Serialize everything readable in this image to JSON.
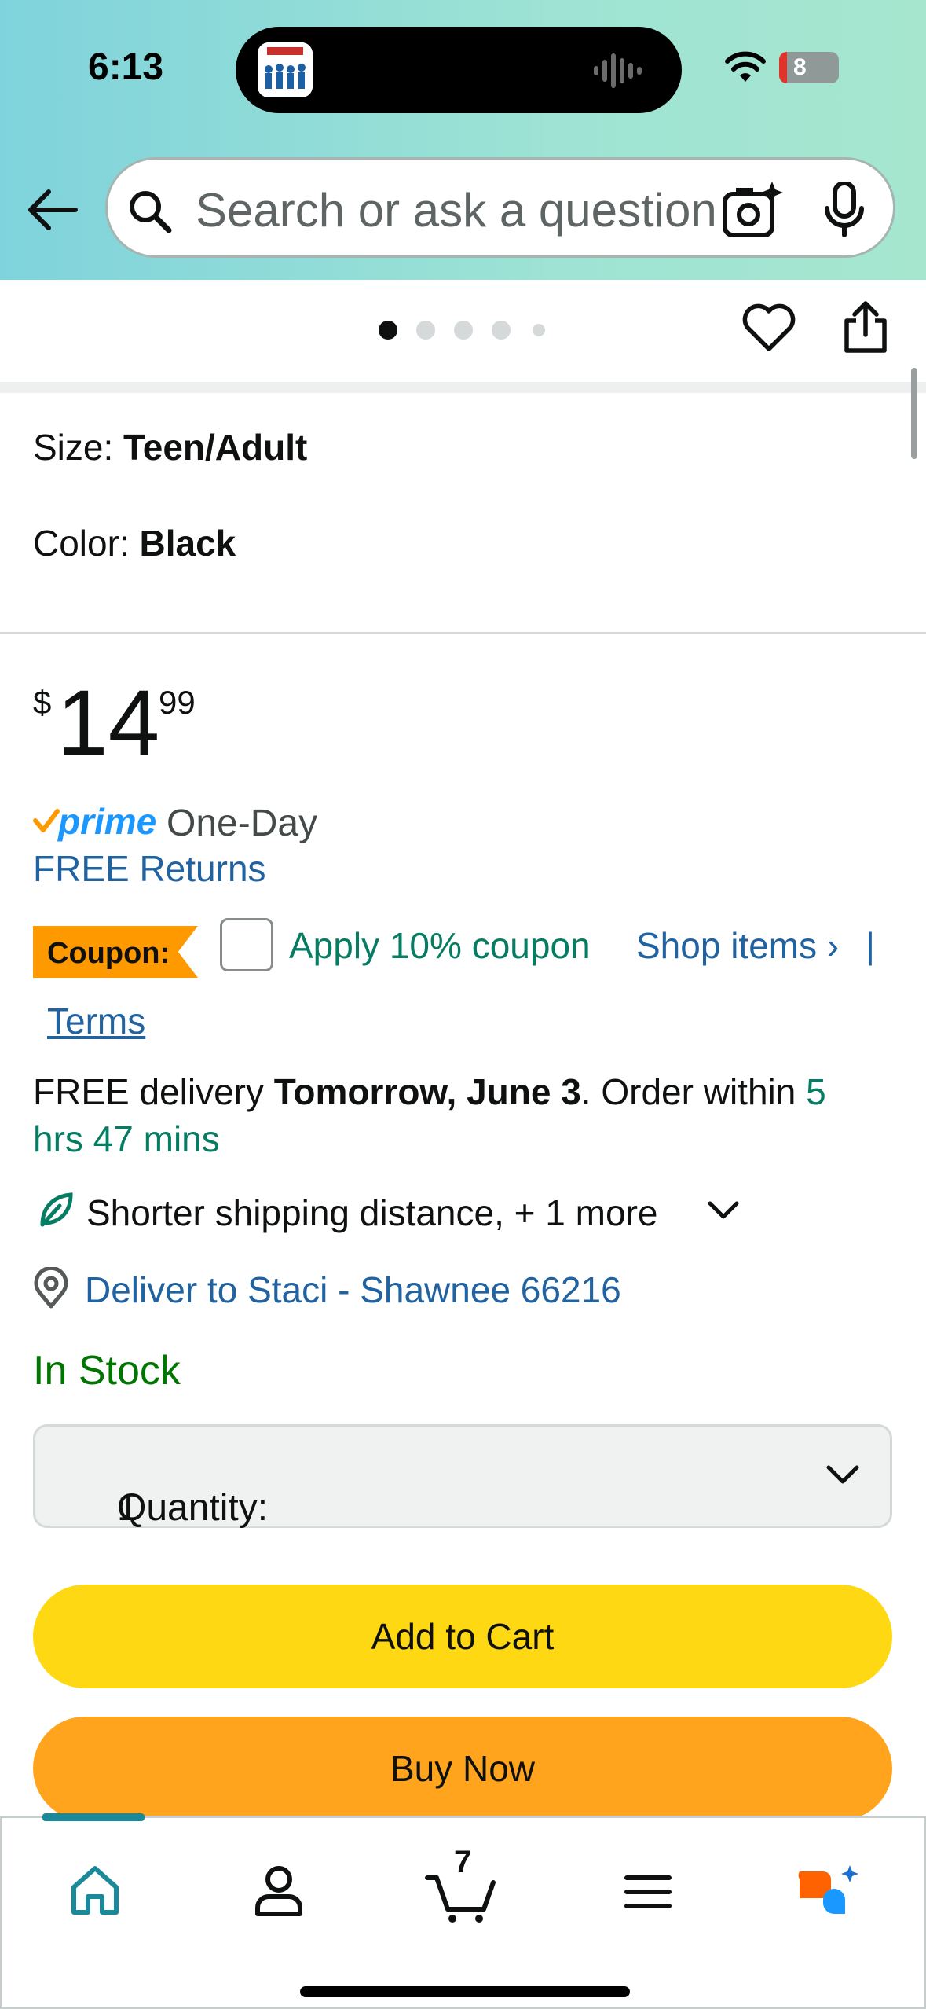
{
  "status_bar": {
    "time": "6:13",
    "battery": "8"
  },
  "search": {
    "placeholder": "Search or ask a question"
  },
  "image_carousel": {
    "dot_count": 5,
    "active_index": 0
  },
  "product": {
    "size_label": "Size:",
    "size_value": "Teen/Adult",
    "color_label": "Color:",
    "color_value": "Black",
    "price_symbol": "$",
    "price_whole": "14",
    "price_fraction": "99",
    "prime_word": "prime",
    "prime_speed": "One-Day",
    "free_returns": "FREE Returns",
    "coupon_badge": "Coupon:",
    "coupon_apply": "Apply 10% coupon",
    "coupon_shop": "Shop items ›",
    "coupon_sep": "|",
    "coupon_terms": "Terms",
    "delivery_prefix": "FREE delivery ",
    "delivery_date": "Tomorrow, June 3",
    "delivery_mid": ". Order within ",
    "delivery_countdown_1": "5",
    "delivery_countdown_2": "hrs 47 mins",
    "shipping_note": "Shorter shipping distance, + 1 more",
    "deliver_to": "Deliver to Staci - Shawnee 66216",
    "stock": "In Stock",
    "quantity_label": "Quantity:",
    "quantity_value": "1",
    "add_to_cart": "Add to Cart",
    "buy_now": "Buy Now"
  },
  "bottom_nav": {
    "cart_count": "7"
  },
  "colors": {
    "accent_teal": "#1a8a9a",
    "add_to_cart": "#ffd814",
    "buy_now": "#ffa41c",
    "link": "#2162a1",
    "green": "#067d62",
    "prime_blue": "#1a98ff"
  }
}
